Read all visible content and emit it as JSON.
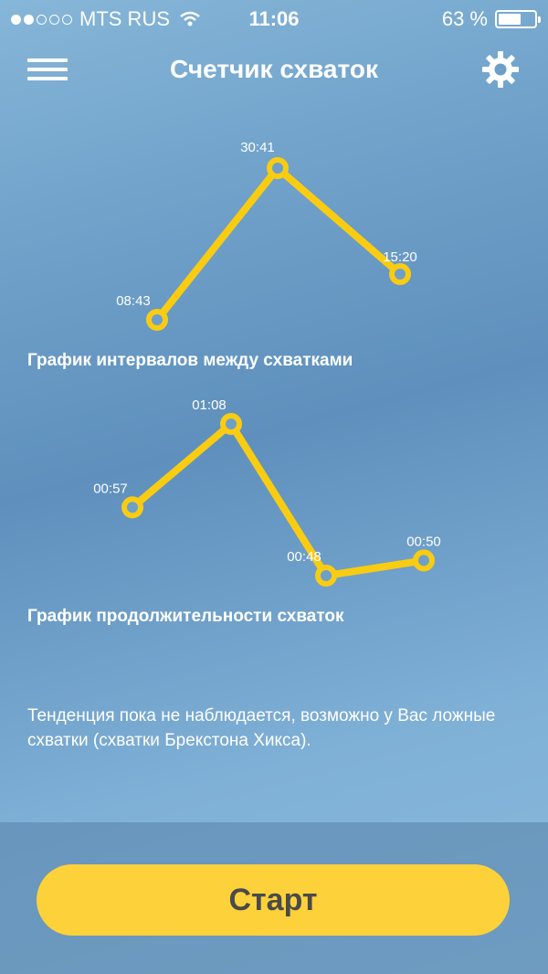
{
  "status_bar": {
    "carrier": "MTS RUS",
    "time": "11:06",
    "battery_text": "63 %",
    "battery_level": 0.63,
    "signal_filled": 2,
    "signal_total": 5
  },
  "nav": {
    "title": "Счетчик схваток",
    "menu_icon": "hamburger-menu-icon",
    "settings_icon": "gear-icon"
  },
  "chart_data": [
    {
      "type": "line",
      "title": "График интервалов между схватками",
      "points": [
        "08:43",
        "30:41",
        "15:20"
      ],
      "values_seconds": [
        523,
        1841,
        920
      ],
      "color": "#f9cc12"
    },
    {
      "type": "line",
      "title": "График продолжительности схваток",
      "points": [
        "00:57",
        "01:08",
        "00:48",
        "00:50"
      ],
      "values_seconds": [
        57,
        68,
        48,
        50
      ],
      "color": "#f9cc12"
    }
  ],
  "message": "Тенденция пока не наблюдается, возможно у Вас ложные схватки (схватки Брекстона Хикса).",
  "start_button": {
    "label": "Старт",
    "color": "#fdd13a"
  }
}
